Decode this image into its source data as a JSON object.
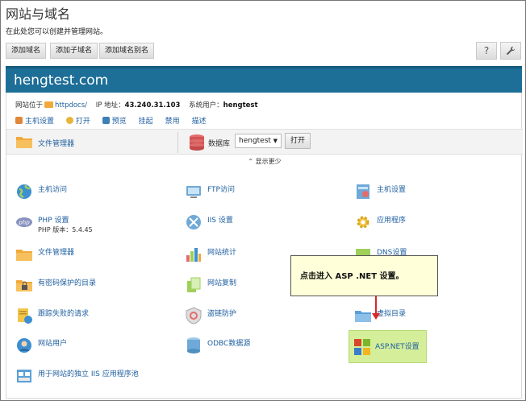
{
  "page": {
    "title": "网站与域名",
    "subtitle": "在此处您可以创建并管理网站。"
  },
  "toolbar": {
    "add_domain": "添加域名",
    "add_subdomain": "添加子域名",
    "add_alias": "添加域名别名",
    "help_icon": "?",
    "settings_icon": "wrench-icon"
  },
  "domain": {
    "name": "hengtest.com",
    "location_label": "网站位于",
    "location_path": "httpdocs/",
    "ip_label": "IP 地址：",
    "ip_value": "43.240.31.103",
    "user_label": "系统用户：",
    "user_value": "hengtest"
  },
  "actions": [
    {
      "label": "主机设置",
      "icon": "hosting-settings-icon"
    },
    {
      "label": "打开",
      "icon": "open-icon"
    },
    {
      "label": "预览",
      "icon": "preview-icon"
    },
    {
      "label": "挂起",
      "icon": ""
    },
    {
      "label": "禁用",
      "icon": ""
    },
    {
      "label": "描述",
      "icon": ""
    }
  ],
  "quick": {
    "file_manager": "文件管理器",
    "database_label": "数据库",
    "database_selected": "hengtest",
    "open_button": "打开"
  },
  "toggle": {
    "label": "显示更少"
  },
  "tools": {
    "col1": [
      {
        "label": "主机访问",
        "icon": "hosting-access-icon"
      },
      {
        "label": "PHP 设置",
        "icon": "php-icon",
        "sub": "PHP 版本：5.4.45"
      },
      {
        "label": "文件管理器",
        "icon": "folder-icon"
      },
      {
        "label": "有密码保护的目录",
        "icon": "protected-folder-icon"
      },
      {
        "label": "跟踪失败的请求",
        "icon": "failed-request-icon"
      },
      {
        "label": "网站用户",
        "icon": "web-users-icon"
      },
      {
        "label": "用于网站的独立 IIS 应用程序池",
        "icon": "app-pool-icon"
      }
    ],
    "col2": [
      {
        "label": "FTP访问",
        "icon": "ftp-icon"
      },
      {
        "label": "IIS 设置",
        "icon": "iis-icon"
      },
      {
        "label": "网站统计",
        "icon": "stats-icon"
      },
      {
        "label": "网站复制",
        "icon": "copy-icon"
      },
      {
        "label": "盗链防护",
        "icon": "hotlink-icon"
      },
      {
        "label": "ODBC数据源",
        "icon": "odbc-icon"
      }
    ],
    "col3": [
      {
        "label": "主机设置",
        "icon": "hosting-settings-icon"
      },
      {
        "label": "应用程序",
        "icon": "applications-icon"
      },
      {
        "label": "DNS设置",
        "icon": "dns-icon"
      },
      {
        "label": "虚拟目录",
        "icon": "virtual-dir-icon"
      },
      {
        "label": "ASP.NET设置",
        "icon": "aspnet-icon"
      }
    ]
  },
  "callout": {
    "text": "点击进入 ASP .NET 设置。"
  },
  "colors": {
    "domain_bar": "#1e6f98",
    "link": "#1f5fa0",
    "highlight": "#d4ee9a",
    "callout_bg": "#ffffd9",
    "arrow": "#d9262a"
  }
}
